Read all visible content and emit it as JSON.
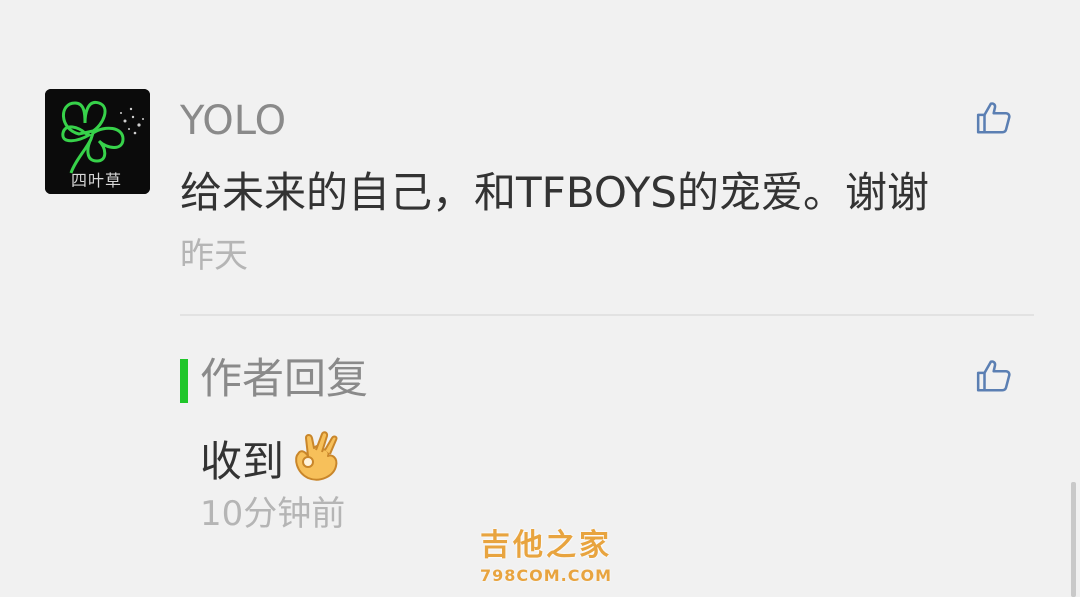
{
  "comment": {
    "username": "YOLO",
    "text": "给未来的自己，和TFBOYS的宠爱。谢谢",
    "time": "昨天",
    "avatar_caption": "四叶草",
    "like_icon": "thumbs-up-icon"
  },
  "reply": {
    "heading": "作者回复",
    "text": "收到",
    "emoji": "ok-hand-icon",
    "time": "10分钟前",
    "like_icon": "thumbs-up-icon"
  },
  "watermark": {
    "title": "吉他之家",
    "url": "798COM.COM"
  },
  "colors": {
    "background": "#f1f1f1",
    "reply_accent": "#1fc62a",
    "like_icon": "#5b7fb3",
    "watermark": "#e8a43f"
  }
}
